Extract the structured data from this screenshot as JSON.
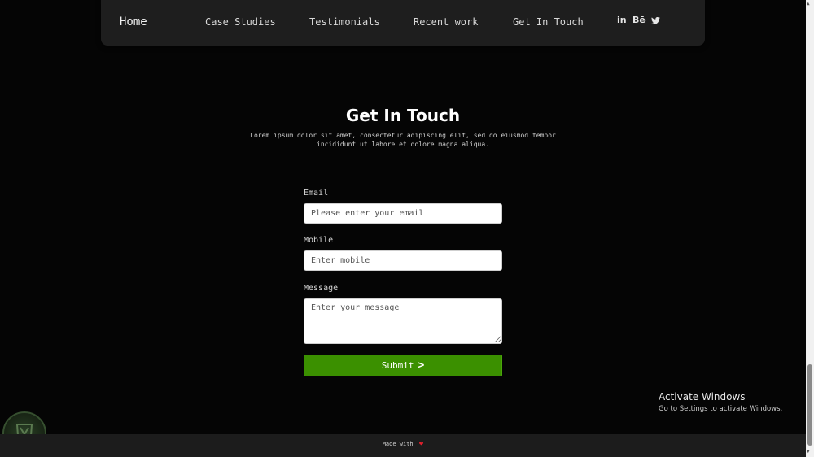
{
  "nav": {
    "home": "Home",
    "case_studies": "Case Studies",
    "testimonials": "Testimonials",
    "recent_work": "Recent work",
    "get_in_touch": "Get In Touch",
    "social": {
      "linkedin": "in",
      "behance": "Bē",
      "twitter": "🐦"
    }
  },
  "contact": {
    "title": "Get In Touch",
    "subtitle": "Lorem ipsum dolor sit amet, consectetur adipiscing elit, sed do eiusmod tempor incididunt ut labore et dolore magna aliqua.",
    "email_label": "Email",
    "email_placeholder": "Please enter your email",
    "mobile_label": "Mobile",
    "mobile_placeholder": "Enter mobile",
    "message_label": "Message",
    "message_placeholder": "Enter your message",
    "submit_label": "Submit",
    "submit_arrow": ">"
  },
  "windows": {
    "activate_title": "Activate Windows",
    "activate_sub": "Go to Settings to activate Windows."
  },
  "footer": {
    "made_with": "Made with",
    "heart": "❤"
  },
  "colors": {
    "background": "#050505",
    "navbar": "#1e1e1e",
    "submit": "#3b9000",
    "heart": "#e0202c"
  }
}
